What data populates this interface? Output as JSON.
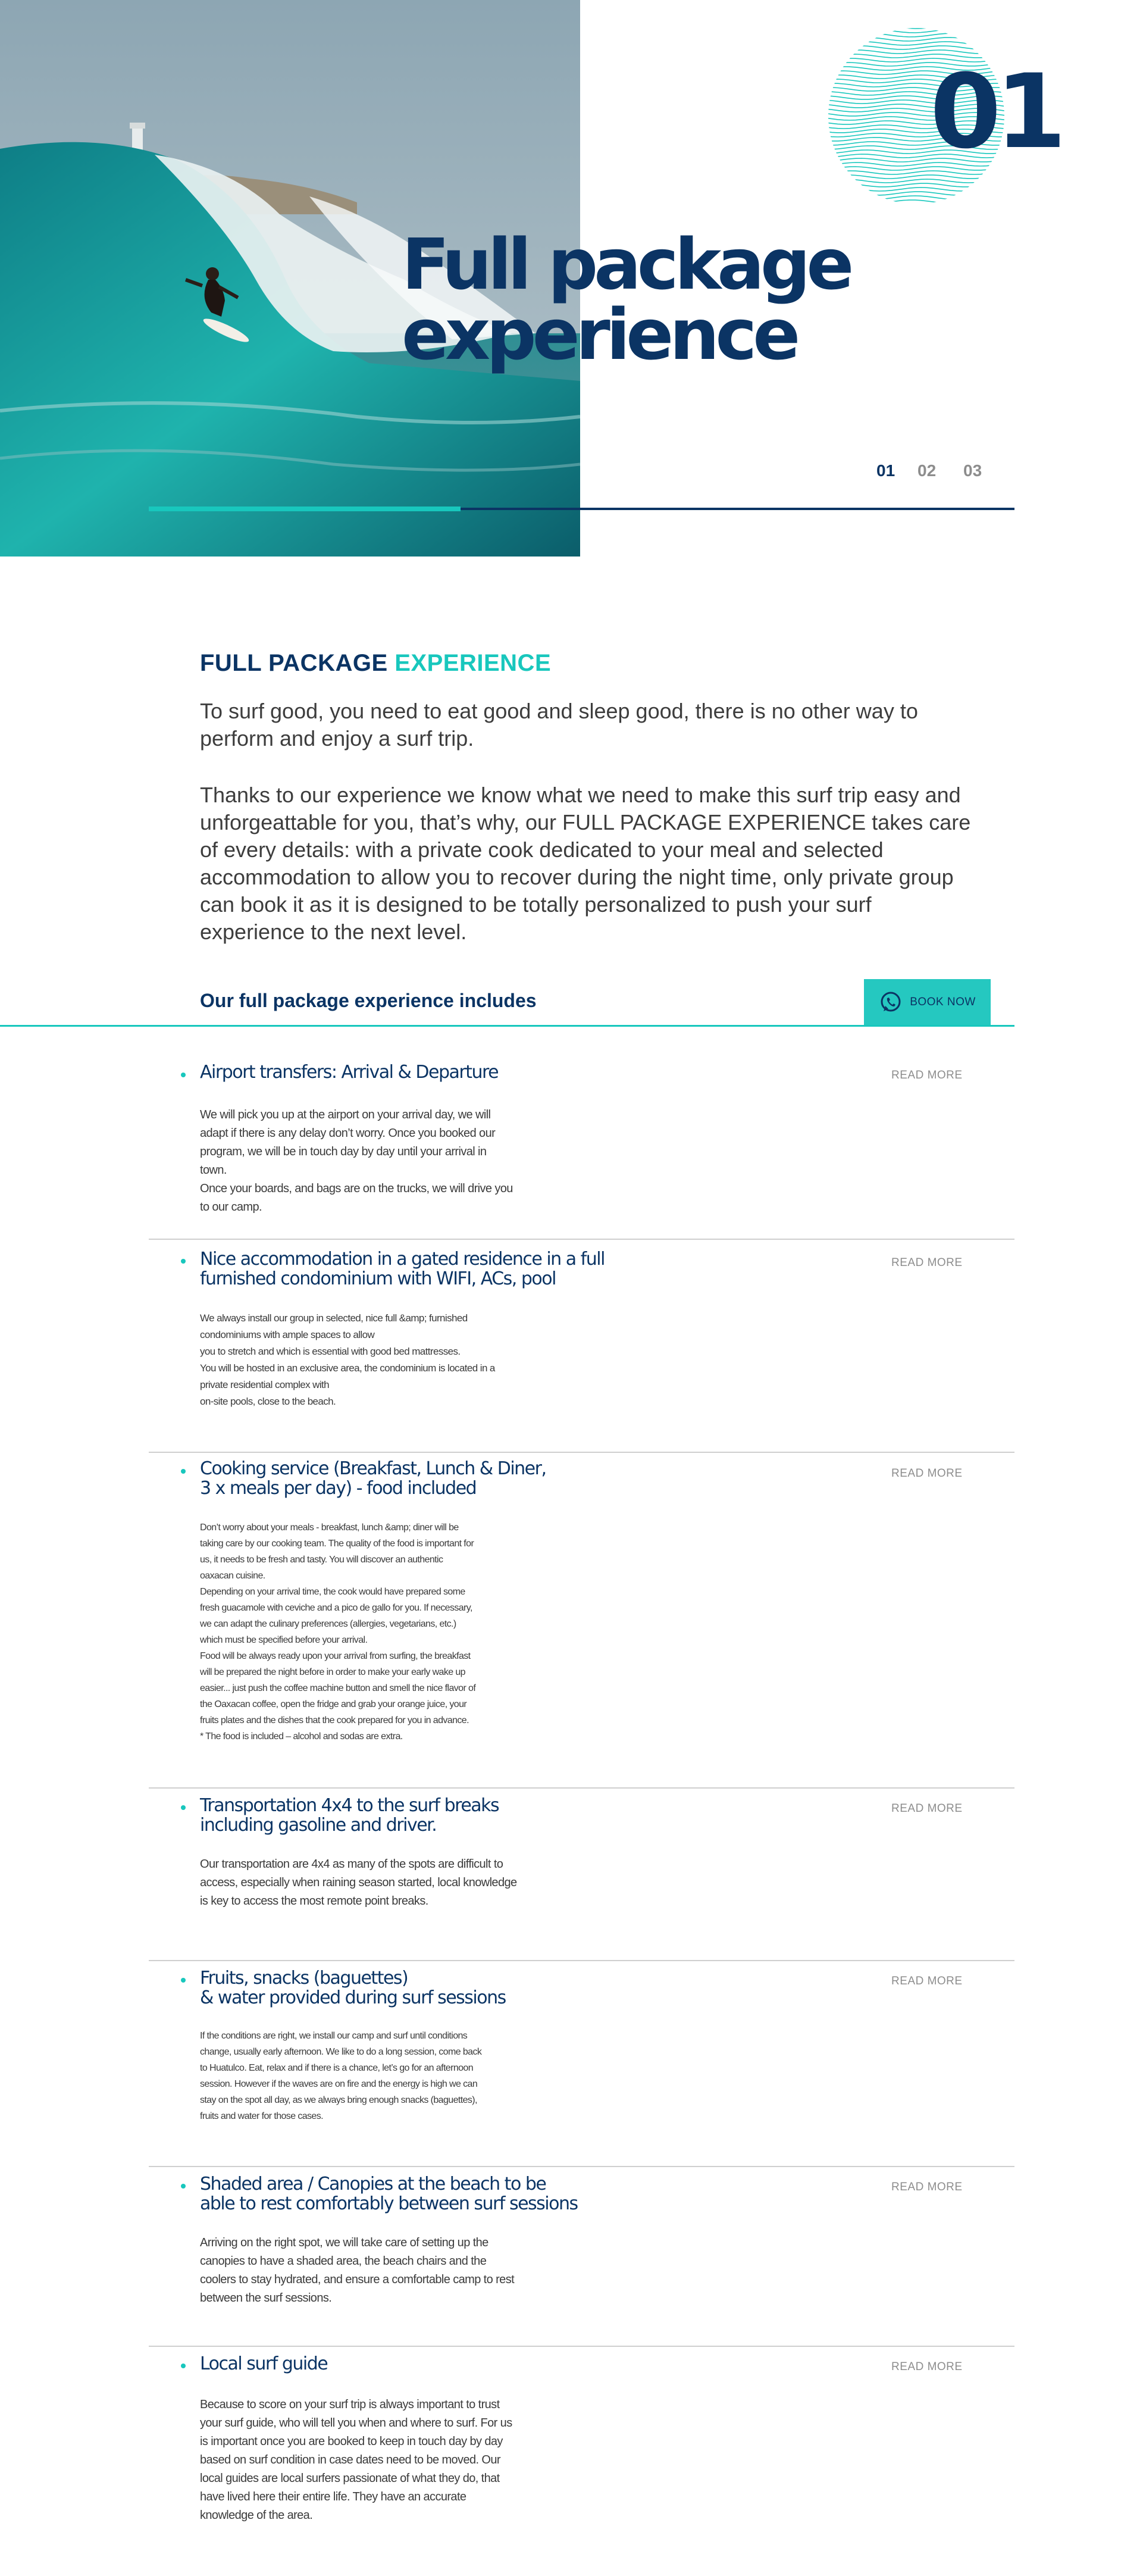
{
  "hero": {
    "number": "01",
    "title_line1": "Full package",
    "title_line2": "experience",
    "pager": [
      "01",
      "02",
      "03"
    ],
    "progress": 0.36
  },
  "intro": {
    "heading_part1": "FULL PACKAGE",
    "heading_part2": "EXPERIENCE",
    "paragraph1": "To surf good, you need to eat good and sleep good, there is no other way to perform and enjoy a surf trip.",
    "paragraph2": "Thanks to our experience we know what we need to make this surf trip easy and unforgeattable for you, that’s why, our FULL PACKAGE EXPERIENCE takes care of every details: with a private cook dedicated to your meal and selected accommodation to allow you to recover during the night time, only private group can book it as it is designed to be totally personalized to push your surf experience to the next level."
  },
  "includes": {
    "title": "Our full package experience includes",
    "book_label": "BOOK NOW",
    "read_more": "READ MORE",
    "items": [
      {
        "title": "Airport transfers: Arrival & Departure",
        "body": "We will pick you up at the airport on your arrival day, we will\nadapt if there is any delay don’t worry. Once you booked our\nprogram, we will be in touch day by day until your arrival in\ntown.\nOnce your boards, and bags are on the trucks, we will drive you\nto our camp."
      },
      {
        "title": "Nice accommodation in a gated residence in a full\nfurnished condominium with WIFI, ACs, pool",
        "body": "We always install our group in selected, nice full &amp; furnished\ncondominiums with ample spaces to allow\nyou to stretch and which is essential with good bed mattresses.\nYou will be hosted in an exclusive area, the condominium is located in a\nprivate residential complex with\non-site pools, close to the beach."
      },
      {
        "title": "Cooking service (Breakfast, Lunch & Diner,\n3 x meals per day) - food included",
        "body": "Don’t worry about your meals - breakfast, lunch &amp; diner will be\ntaking care by our cooking team. The quality of the food is important for\nus, it needs to be fresh and tasty. You will discover an authentic\noaxacan cuisine.\nDepending on your arrival time, the cook would have prepared some\nfresh guacamole with ceviche and a pico de gallo for you. If necessary,\nwe can adapt the culinary preferences (allergies, vegetarians, etc.)\nwhich must be specified before your arrival.\nFood will be always ready upon your arrival from surfing, the breakfast\nwill be prepared the night before in order to make your early wake up\neasier... just push the coffee machine button and smell the nice flavor of\nthe Oaxacan coffee, open the fridge and grab your orange juice, your\nfruits plates and the dishes that the cook prepared for you in advance.\n* The food is included – alcohol and sodas are extra."
      },
      {
        "title": "Transportation 4x4 to the surf breaks\nincluding gasoline and driver.",
        "body": "Our transportation are 4x4 as many of the spots are difficult to\naccess, especially when raining season started, local knowledge\nis key to access the most remote point breaks."
      },
      {
        "title": "Fruits, snacks (baguettes)\n& water provided during surf sessions",
        "body": "If the conditions are right, we install our camp and surf until conditions\nchange, usually early afternoon. We like to do a long session, come back\nto Huatulco. Eat, relax and if there is a chance, let’s go for an afternoon\nsession. However if the waves are on fire and the energy is high we can\nstay on the spot all day, as we always bring enough snacks (baguettes),\nfruits and water for those cases."
      },
      {
        "title": "Shaded area / Canopies at the beach to be\nable to rest comfortably between surf sessions",
        "body": "Arriving on the right spot, we will take care of setting up the\ncanopies to have a shaded area, the beach chairs and the\ncoolers to stay hydrated, and ensure a comfortable camp to rest\nbetween the surf sessions."
      },
      {
        "title": "Local surf guide",
        "body": "Because to score on your surf trip is always important to trust\nyour surf guide, who will tell you when and where to surf. For us\nis important once you are booked to keep in touch day by day\nbased on surf condition in case dates need to be moved. Our\nlocal guides are local surfers passionate of what they do, that\nhave lived here their entire life. They have an accurate\nknowledge of the area."
      }
    ]
  },
  "colors": {
    "navy": "#0b3464",
    "teal": "#18c7bd",
    "button": "#25c8c0",
    "muted": "#8d8d8d"
  },
  "icons": [
    "whatsapp-icon",
    "wave-circle-graphic"
  ]
}
